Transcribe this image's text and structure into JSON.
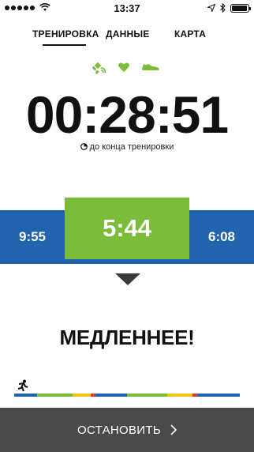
{
  "status_bar": {
    "time": "13:37",
    "battery_level": 0.95,
    "icons": [
      "signal-dots",
      "wifi-icon",
      "location-arrow-icon",
      "bluetooth-icon",
      "battery-icon"
    ]
  },
  "tabs": [
    {
      "label": "ТРЕНИРОВКА",
      "active": true
    },
    {
      "label": "ДАННЫЕ",
      "active": false
    },
    {
      "label": "КАРТА",
      "active": false
    }
  ],
  "sensors": {
    "color": "#7bbd3a",
    "icons": [
      "gps-satellite-icon",
      "heart-icon",
      "shoe-icon"
    ]
  },
  "timer": {
    "value": "00:28:51",
    "subtitle": "до конца тренировки"
  },
  "pace": {
    "min": "9:55",
    "current": "5:44",
    "max": "6:08",
    "colors": {
      "range": "#1f64ad",
      "current": "#7bbd3a"
    }
  },
  "message": "МЕДЛЕННЕЕ!",
  "progress": {
    "segments": [
      {
        "color": "#1f64ad",
        "fraction": 0.1
      },
      {
        "color": "#7bbd3a",
        "fraction": 0.16
      },
      {
        "color": "#f0c419",
        "fraction": 0.08
      },
      {
        "color": "#d93a2b",
        "fraction": 0.02
      },
      {
        "color": "#1f64ad",
        "fraction": 0.14
      },
      {
        "color": "#7bbd3a",
        "fraction": 0.18
      },
      {
        "color": "#f0c419",
        "fraction": 0.11
      },
      {
        "color": "#d93a2b",
        "fraction": 0.02
      },
      {
        "color": "#1f64ad",
        "fraction": 0.19
      }
    ]
  },
  "stop_button": {
    "label": "ОСТАНОВИТЬ"
  }
}
